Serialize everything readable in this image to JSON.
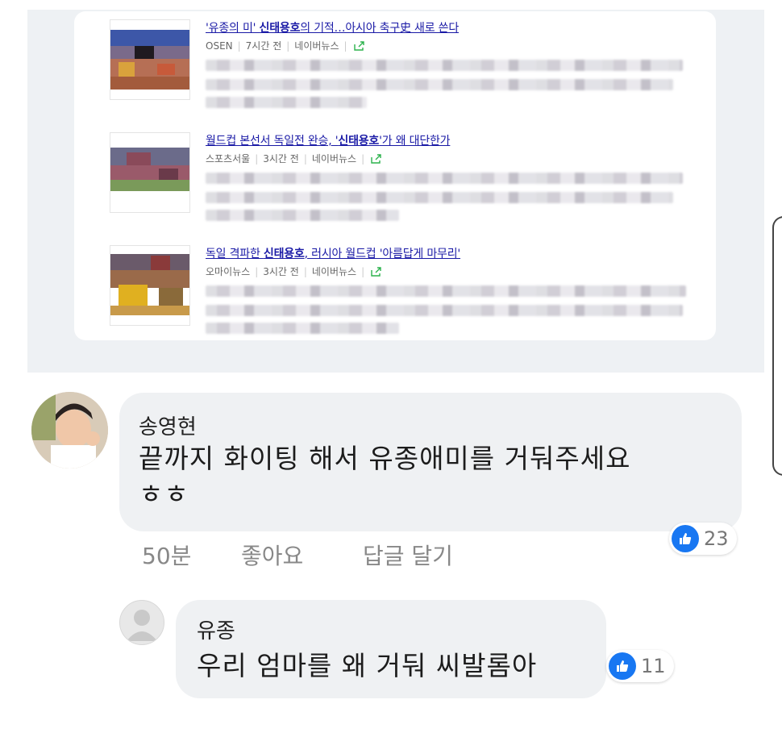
{
  "news": [
    {
      "title_pre": "'유종의 미' ",
      "title_bold": "신태용호",
      "title_post": "의 기적…아시아 축구史 새로 쓴다",
      "source": "OSEN",
      "time": "7시간 전",
      "platform": "네이버뉴스"
    },
    {
      "title_pre": "월드컵 본선서 독일전 완승, '",
      "title_bold": "신태용호",
      "title_post": "'가 왜 대단한가",
      "source": "스포츠서울",
      "time": "3시간 전",
      "platform": "네이버뉴스"
    },
    {
      "title_pre": "독일 격파한 ",
      "title_bold": "신태용호",
      "title_post": ", 러시아 월드컵 '아름답게 마무리'",
      "source": "오마이뉴스",
      "time": "3시간 전",
      "platform": "네이버뉴스"
    }
  ],
  "comment": {
    "author": "송영현",
    "text_line1": "끝까지 화이팅 해서 유종애미를 거둬주세요",
    "text_line2": "ㅎㅎ",
    "time": "50분",
    "like_label": "좋아요",
    "reply_label": "답글 달기",
    "likes": "23"
  },
  "reply": {
    "author": "유종",
    "text": "우리 엄마를 왜 거둬 씨발롬아",
    "likes": "11"
  },
  "colors": {
    "link": "#1a1aa6",
    "like_blue": "#1877f2",
    "bubble": "#eff1f3",
    "panel": "#eef1f4"
  },
  "icons": [
    "share-icon",
    "like-thumb-icon",
    "default-avatar-icon"
  ]
}
